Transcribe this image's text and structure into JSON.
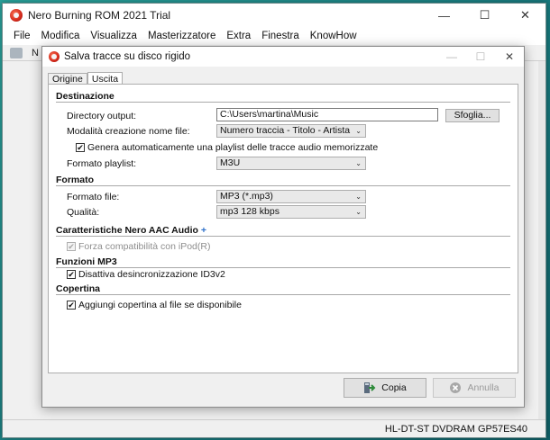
{
  "main": {
    "title": "Nero Burning ROM 2021 Trial",
    "menu": [
      "File",
      "Modifica",
      "Visualizza",
      "Masterizzatore",
      "Extra",
      "Finestra",
      "KnowHow"
    ],
    "toolbar_text": "N",
    "status": "HL-DT-ST DVDRAM GP57ES40"
  },
  "dialog": {
    "title": "Salva tracce su disco rigido",
    "tabs": [
      {
        "label": "Origine"
      },
      {
        "label": "Uscita"
      }
    ],
    "destinazione": {
      "title": "Destinazione",
      "directory_label": "Directory output:",
      "directory_value": "C:\\Users\\martina\\Music",
      "browse_label": "Sfoglia...",
      "naming_label": "Modalità creazione nome file:",
      "naming_value": "Numero traccia - Titolo - Artista",
      "playlist_check_label": "Genera automaticamente una playlist delle tracce audio memorizzate",
      "playlist_format_label": "Formato playlist:",
      "playlist_format_value": "M3U"
    },
    "formato": {
      "title": "Formato",
      "file_label": "Formato file:",
      "file_value": "MP3 (*.mp3)",
      "quality_label": "Qualità:",
      "quality_value": "mp3 128 kbps"
    },
    "aac": {
      "title": "Caratteristiche Nero AAC Audio",
      "ipod_label": "Forza compatibilità con iPod(R)"
    },
    "mp3": {
      "title": "Funzioni MP3",
      "id3_label": "Disattiva desincronizzazione ID3v2"
    },
    "copertina": {
      "title": "Copertina",
      "cover_label": "Aggiungi copertina al file se disponibile"
    },
    "buttons": {
      "copy": "Copia",
      "cancel": "Annulla"
    }
  },
  "colors": {
    "desktop": "#1d8a8a",
    "copy_icon": "#2e8b3a",
    "cancel_icon": "#9a9a9a"
  }
}
